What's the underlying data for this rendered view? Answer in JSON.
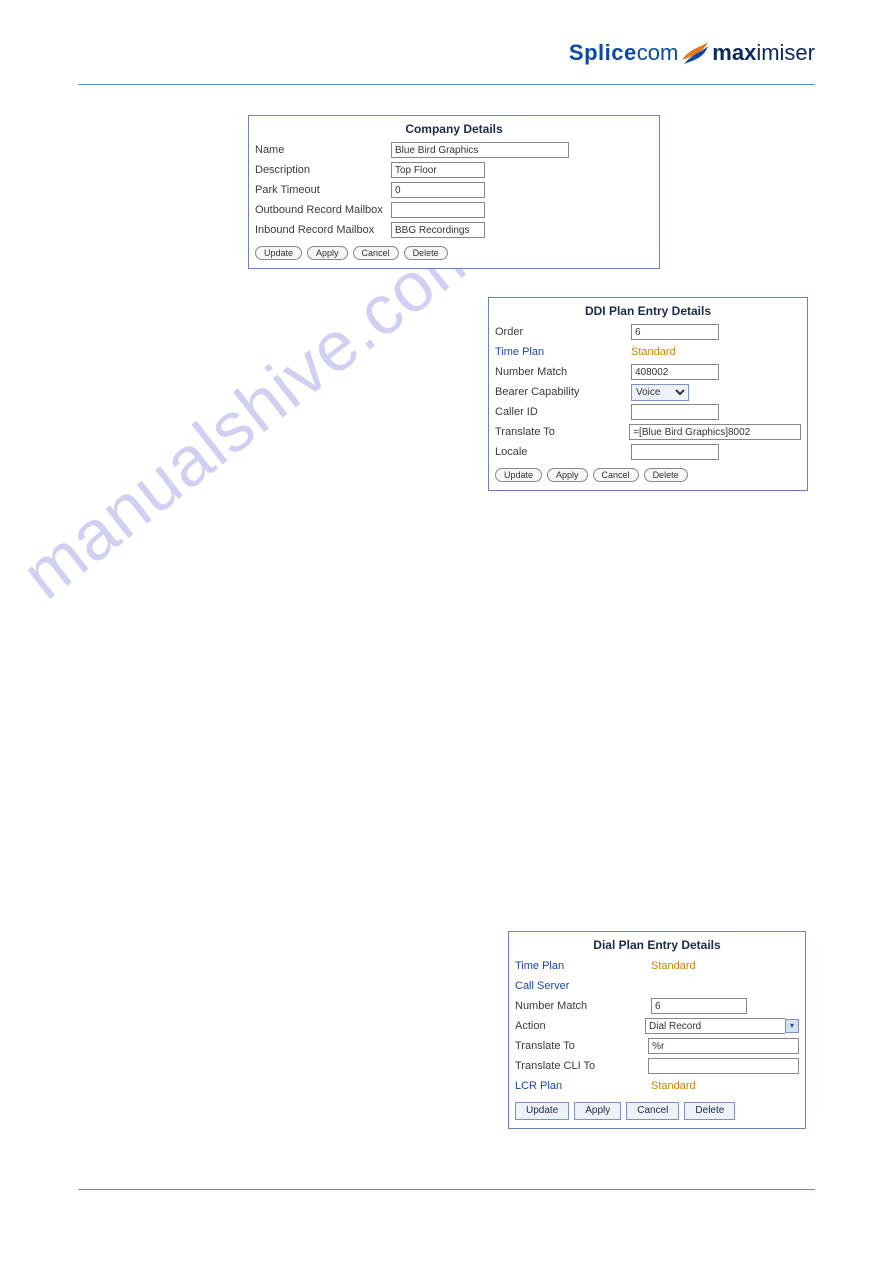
{
  "logo": {
    "part1": "Splice",
    "part2": "com",
    "part3": "max",
    "part4": "imiser"
  },
  "watermark": "manualshive.com",
  "panel1": {
    "title": "Company Details",
    "name_label": "Name",
    "name_value": "Blue Bird Graphics",
    "description_label": "Description",
    "description_value": "Top Floor",
    "park_timeout_label": "Park Timeout",
    "park_timeout_value": "0",
    "out_mailbox_label": "Outbound Record Mailbox",
    "out_mailbox_value": "",
    "in_mailbox_label": "Inbound Record Mailbox",
    "in_mailbox_value": "BBG Recordings",
    "btn_update": "Update",
    "btn_apply": "Apply",
    "btn_cancel": "Cancel",
    "btn_delete": "Delete"
  },
  "panel2": {
    "title": "DDI Plan Entry Details",
    "order_label": "Order",
    "order_value": "6",
    "time_plan_label": "Time Plan",
    "time_plan_value": "Standard",
    "number_match_label": "Number Match",
    "number_match_value": "408002",
    "bearer_label": "Bearer Capability",
    "bearer_value": "Voice",
    "caller_id_label": "Caller ID",
    "caller_id_value": "",
    "translate_to_label": "Translate To",
    "translate_to_value": "=[Blue Bird Graphics]8002",
    "locale_label": "Locale",
    "locale_value": "",
    "btn_update": "Update",
    "btn_apply": "Apply",
    "btn_cancel": "Cancel",
    "btn_delete": "Delete"
  },
  "panel3": {
    "title": "Dial Plan Entry Details",
    "time_plan_label": "Time Plan",
    "time_plan_value": "Standard",
    "call_server_label": "Call Server",
    "call_server_value": "",
    "number_match_label": "Number Match",
    "number_match_value": "6",
    "action_label": "Action",
    "action_value": "Dial Record",
    "translate_to_label": "Translate To",
    "translate_to_value": "%r",
    "translate_cli_label": "Translate CLI To",
    "translate_cli_value": "",
    "lcr_plan_label": "LCR Plan",
    "lcr_plan_value": "Standard",
    "btn_update": "Update",
    "btn_apply": "Apply",
    "btn_cancel": "Cancel",
    "btn_delete": "Delete"
  }
}
